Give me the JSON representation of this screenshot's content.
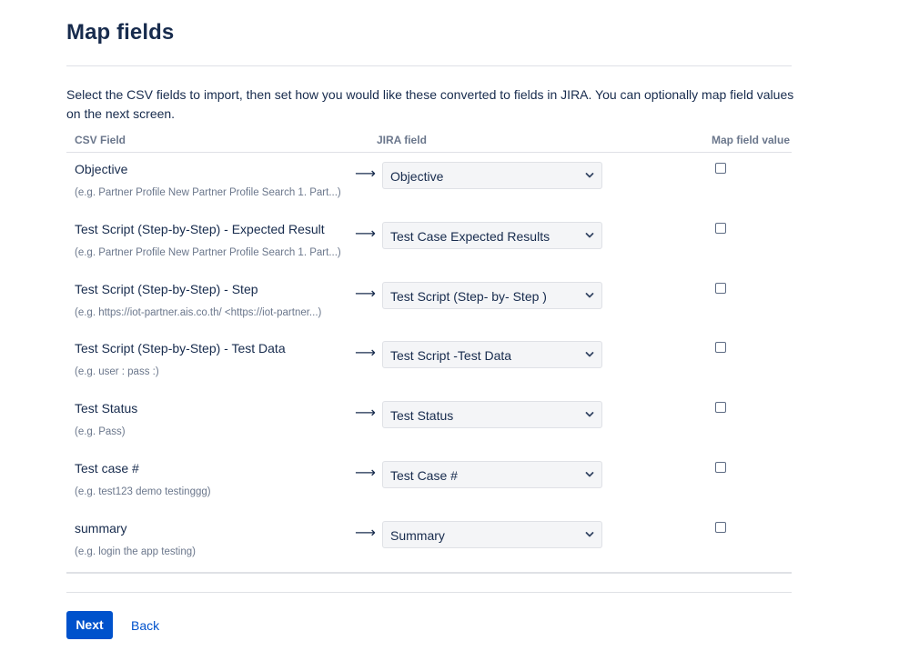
{
  "page": {
    "title": "Map fields",
    "description": "Select the CSV fields to import, then set how you would like these converted to fields in JIRA. You can optionally map field values on the next screen."
  },
  "table": {
    "headers": {
      "csv": "CSV Field",
      "jira": "JIRA field",
      "map": "Map field value"
    },
    "arrow": "⟶",
    "rows": [
      {
        "csv": "Objective",
        "example": "(e.g. Partner Profile New Partner Profile Search 1. Part...)",
        "jira": "Objective",
        "map_checked": false
      },
      {
        "csv": "Test Script (Step-by-Step) - Expected Result",
        "example": "(e.g. Partner Profile New Partner Profile Search 1. Part...)",
        "jira": "Test Case Expected Results",
        "map_checked": false
      },
      {
        "csv": "Test Script (Step-by-Step) - Step",
        "example": "(e.g. https://iot-partner.ais.co.th/ <https://iot-partner...)",
        "jira": "Test Script (Step- by- Step )",
        "map_checked": false
      },
      {
        "csv": "Test Script (Step-by-Step) - Test Data",
        "example": "(e.g. user : pass :)",
        "jira": "Test Script -Test Data",
        "map_checked": false
      },
      {
        "csv": "Test Status",
        "example": "(e.g. Pass)",
        "jira": "Test Status",
        "map_checked": false
      },
      {
        "csv": "Test case #",
        "example": "(e.g. test123 demo testinggg)",
        "jira": "Test Case #",
        "map_checked": false
      },
      {
        "csv": "summary",
        "example": "(e.g. login the app testing)",
        "jira": "Summary",
        "map_checked": false
      }
    ]
  },
  "actions": {
    "next": "Next",
    "back": "Back"
  },
  "colors": {
    "primary": "#0052cc",
    "text": "#172b4d",
    "subtle": "#6b778c",
    "border": "#dfe1e6",
    "select_bg": "#f4f5f7"
  },
  "icons": {
    "select": "chevron-down-icon",
    "mapping": "arrow-right-icon"
  }
}
